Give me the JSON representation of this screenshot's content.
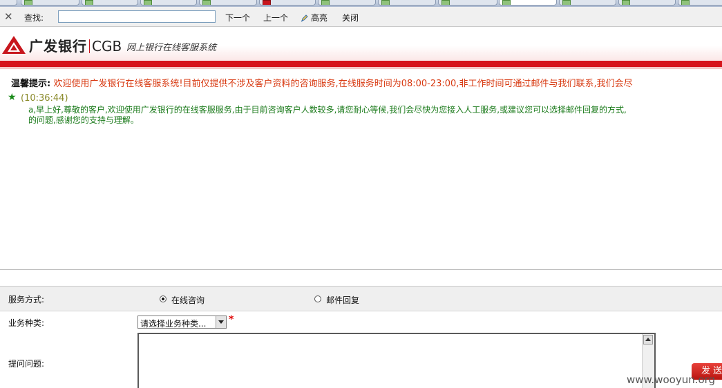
{
  "findbar": {
    "label": "查找:",
    "input_value": "",
    "next": "下一个",
    "prev": "上一个",
    "highlight": "高亮",
    "close": "关闭"
  },
  "header": {
    "brand_cn": "广发银行",
    "brand_en": "CGB",
    "subtitle": "网上银行在线客服系统"
  },
  "notice": {
    "label": "温馨提示:",
    "text": "欢迎使用广发银行在线客服系统!目前仅提供不涉及客户资料的咨询服务,在线服务时间为08:00-23:00,非工作时间可通过邮件与我们联系,我们会尽"
  },
  "message": {
    "time": "(10:36:44)",
    "line1": "a,早上好,尊敬的客户,欢迎使用广发银行的在线客服服务,由于目前咨询客户人数较多,请您耐心等候,我们会尽快为您接入人工服务,或建议您可以选择邮件回复的方式,",
    "line2": "的问题,感谢您的支持与理解。"
  },
  "form": {
    "service_label": "服务方式:",
    "option_online": "在线咨询",
    "option_email": "邮件回复",
    "category_label": "业务种类:",
    "category_value": "请选择业务种类...",
    "required_mark": "*",
    "question_label": "提问问题:",
    "send": "发送"
  },
  "watermark": "www.wooyun.org",
  "colors": {
    "brand_red": "#d6141c",
    "notice_text": "#d83a12",
    "message_green": "#1a7a1a"
  }
}
